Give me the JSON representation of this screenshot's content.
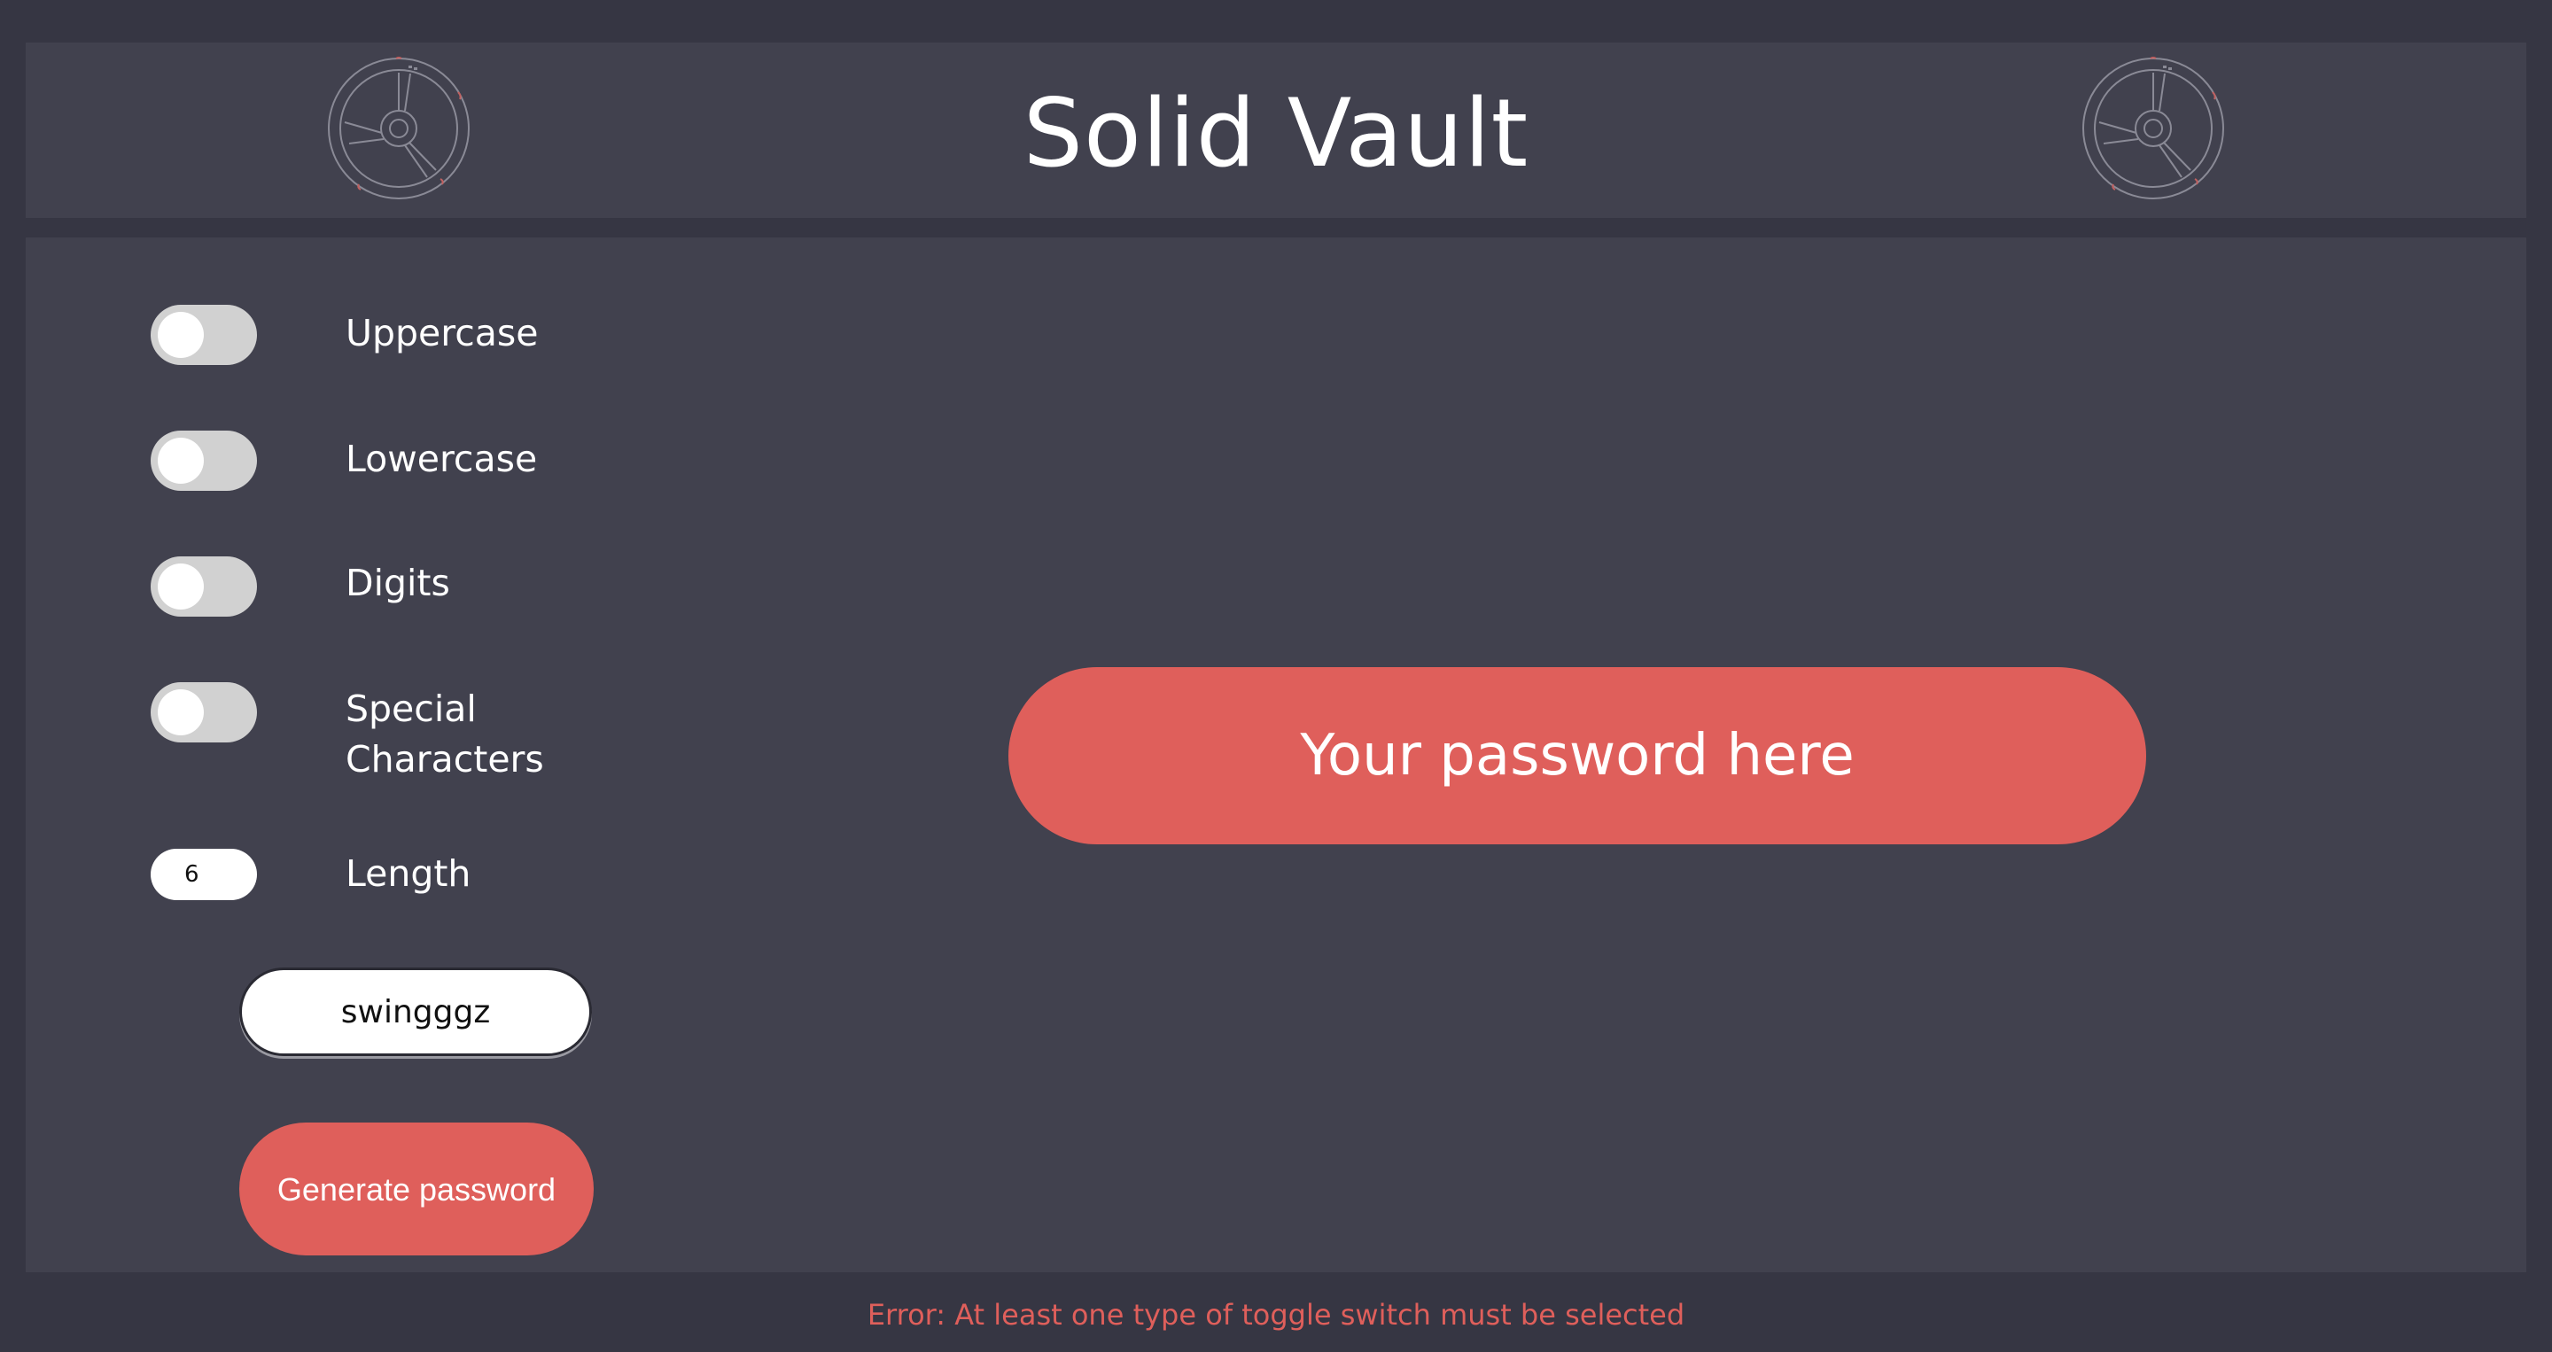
{
  "header": {
    "title": "Solid Vault",
    "left_icon": "vault-icon",
    "right_icon": "vault-icon"
  },
  "options": [
    {
      "label": "Uppercase",
      "enabled": false
    },
    {
      "label": "Lowercase",
      "enabled": false
    },
    {
      "label": "Digits",
      "enabled": false
    },
    {
      "label_line1": "Special",
      "label_line2": "Characters",
      "enabled": false
    }
  ],
  "length": {
    "label": "Length",
    "value": "6"
  },
  "seed": {
    "value": "swingggz"
  },
  "generate_button": {
    "label": "Generate password"
  },
  "password_display": {
    "text": "Your password here"
  },
  "error": {
    "message": "Error: At least one type of toggle switch must be selected"
  },
  "colors": {
    "background": "#363643",
    "panel": "#41414e",
    "accent": "#df5f5b",
    "toggle_off": "#d1d1d1",
    "text": "#ffffff"
  }
}
